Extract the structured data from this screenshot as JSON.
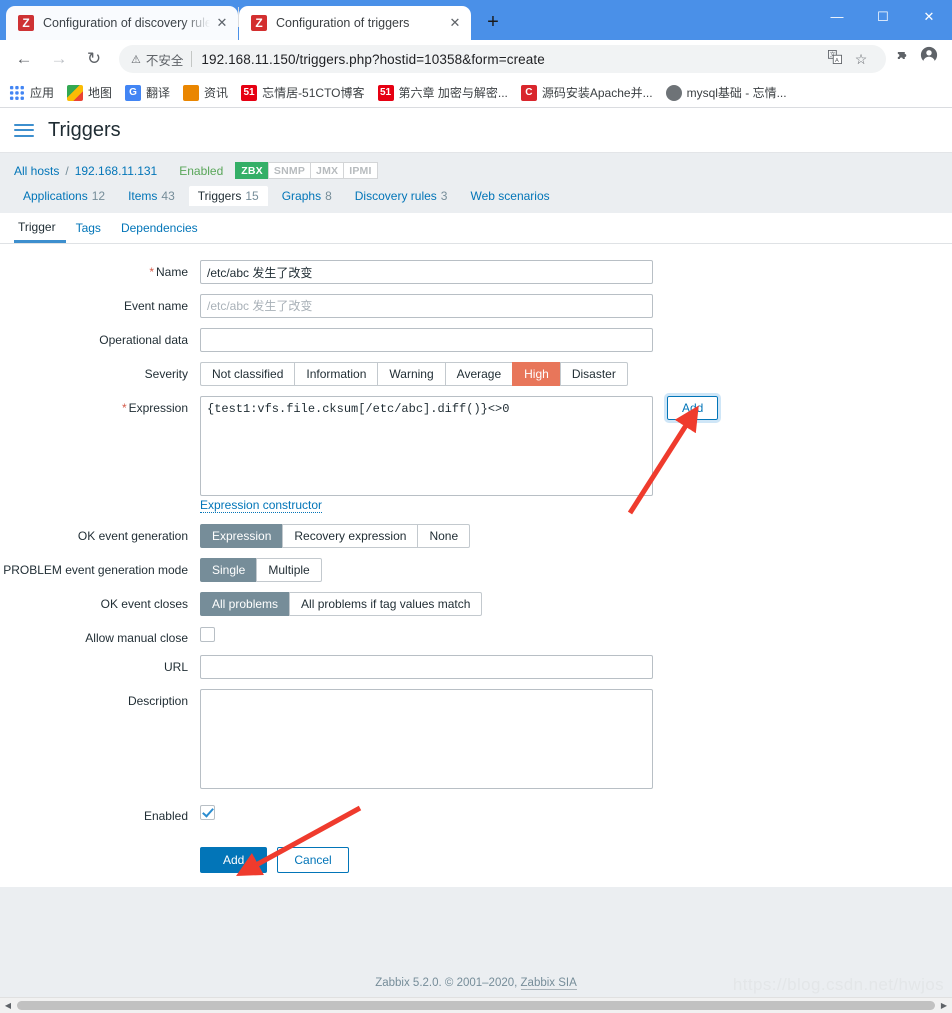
{
  "browser": {
    "tabs": [
      {
        "title": "Configuration of discovery rules",
        "favicon": "zabbix-z-icon",
        "active": false,
        "close": "✕"
      },
      {
        "title": "Configuration of triggers",
        "favicon": "zabbix-z-icon",
        "active": true,
        "close": "✕"
      }
    ],
    "new_tab_label": "+",
    "window_controls": {
      "minimize": "—",
      "maximize": "☐",
      "close": "✕"
    },
    "nav": {
      "back": "←",
      "forward": "→",
      "reload": "↻"
    },
    "omnibox": {
      "warning_icon": "⚠",
      "warning_text": "不安全",
      "url": "192.168.11.150/triggers.php?hostid=10358&form=create"
    },
    "toolbar_icons": {
      "translate": "translate-icon",
      "bookmark_star": "☆",
      "extensions": "✦",
      "profile": "●"
    },
    "bookmarks": [
      {
        "label": "应用",
        "icon": "apps"
      },
      {
        "label": "地图",
        "icon": "maps"
      },
      {
        "label": "翻译",
        "icon": "translate"
      },
      {
        "label": "资讯",
        "icon": "news"
      },
      {
        "label": "忘情居-51CTO博客",
        "icon": "cto",
        "icon_text": "51"
      },
      {
        "label": "第六章 加密与解密...",
        "icon": "cto",
        "icon_text": "51"
      },
      {
        "label": "源码安装Apache并...",
        "icon": "csdn",
        "icon_text": "C"
      },
      {
        "label": "mysql基础 - 忘情...",
        "icon": "globe"
      }
    ]
  },
  "zabbix": {
    "header": {
      "menu_icon": "hamburger-icon",
      "title": "Triggers"
    },
    "host": {
      "all_hosts_label": "All hosts",
      "separator": "/",
      "host_name": "192.168.11.131",
      "status": "Enabled",
      "interfaces": [
        {
          "label": "ZBX",
          "active": true
        },
        {
          "label": "SNMP",
          "active": false
        },
        {
          "label": "JMX",
          "active": false
        },
        {
          "label": "IPMI",
          "active": false
        }
      ],
      "tabs": [
        {
          "label": "Applications",
          "count": "12",
          "selected": false
        },
        {
          "label": "Items",
          "count": "43",
          "selected": false
        },
        {
          "label": "Triggers",
          "count": "15",
          "selected": true
        },
        {
          "label": "Graphs",
          "count": "8",
          "selected": false
        },
        {
          "label": "Discovery rules",
          "count": "3",
          "selected": false
        },
        {
          "label": "Web scenarios",
          "count": "",
          "selected": false
        }
      ]
    },
    "form_tabs": [
      {
        "label": "Trigger",
        "selected": true
      },
      {
        "label": "Tags",
        "selected": false
      },
      {
        "label": "Dependencies",
        "selected": false
      }
    ],
    "form": {
      "name": {
        "label": "Name",
        "required": true,
        "value": "/etc/abc 发生了改变",
        "placeholder": ""
      },
      "event_name": {
        "label": "Event name",
        "required": false,
        "value": "",
        "placeholder": "/etc/abc 发生了改变"
      },
      "operational_data": {
        "label": "Operational data",
        "required": false,
        "value": "",
        "placeholder": ""
      },
      "severity": {
        "label": "Severity",
        "options": [
          "Not classified",
          "Information",
          "Warning",
          "Average",
          "High",
          "Disaster"
        ],
        "selected": "High"
      },
      "expression": {
        "label": "Expression",
        "required": true,
        "value": "{test1:vfs.file.cksum[/etc/abc].diff()}<>0",
        "add_button": "Add",
        "constructor_link": "Expression constructor"
      },
      "ok_event_generation": {
        "label": "OK event generation",
        "options": [
          "Expression",
          "Recovery expression",
          "None"
        ],
        "selected": "Expression"
      },
      "problem_event_generation_mode": {
        "label": "PROBLEM event generation mode",
        "options": [
          "Single",
          "Multiple"
        ],
        "selected": "Single"
      },
      "ok_event_closes": {
        "label": "OK event closes",
        "options": [
          "All problems",
          "All problems if tag values match"
        ],
        "selected": "All problems"
      },
      "allow_manual_close": {
        "label": "Allow manual close",
        "checked": false
      },
      "url": {
        "label": "URL",
        "value": "",
        "placeholder": ""
      },
      "description": {
        "label": "Description",
        "value": "",
        "placeholder": ""
      },
      "enabled": {
        "label": "Enabled",
        "checked": true
      },
      "submit": "Add",
      "cancel": "Cancel"
    },
    "footer": {
      "text": "Zabbix 5.2.0. © 2001–2020, ",
      "link": "Zabbix SIA"
    },
    "watermark": "https://blog.csdn.net/hwjos"
  }
}
